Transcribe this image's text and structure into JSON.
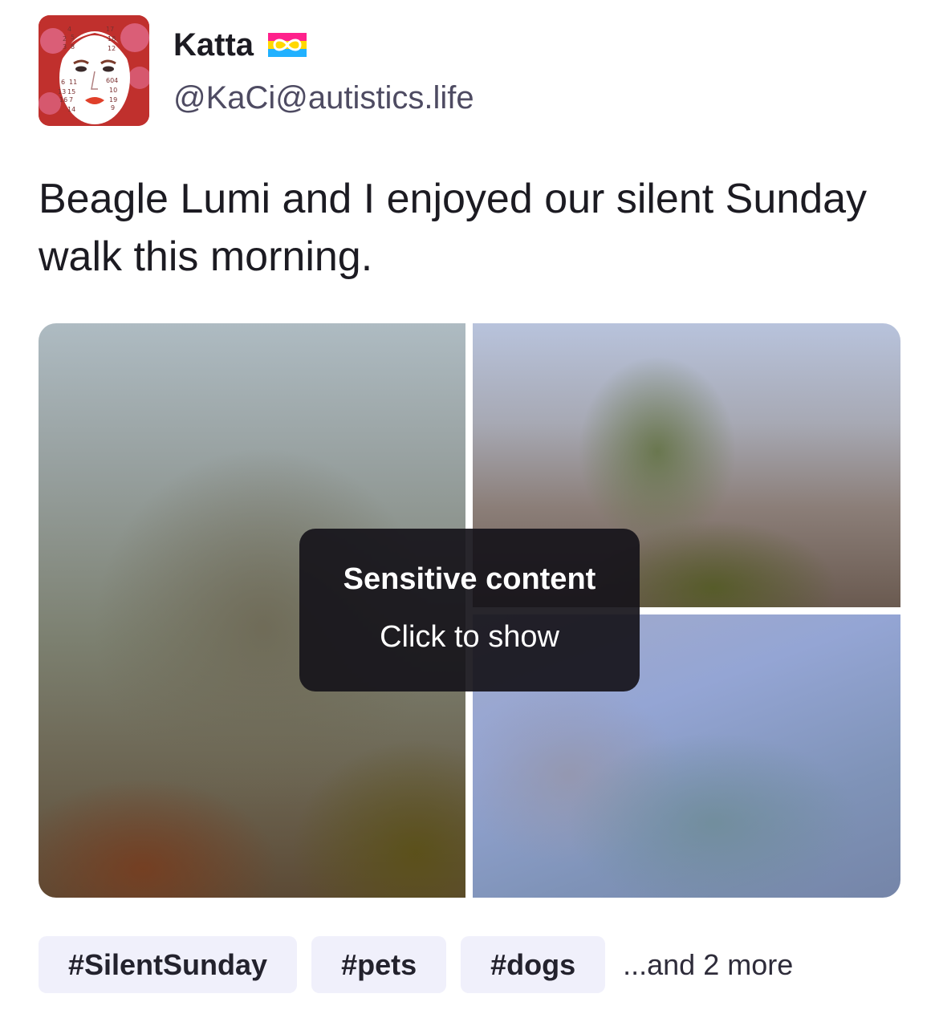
{
  "account": {
    "display_name": "Katta",
    "flag_icon": "pansexual-infinity-flag-icon",
    "handle": "@KaCi@autistics.life",
    "avatar_numbers": [
      "4",
      "17",
      "2",
      "5",
      "18",
      "3",
      "8",
      "12",
      "6",
      "11",
      "604",
      "13",
      "15",
      "10",
      "16",
      "7",
      "19",
      "14",
      "9"
    ]
  },
  "post": {
    "text": "Beagle Lumi and I enjoyed our silent Sunday walk this morning."
  },
  "media": {
    "sensitive_title": "Sensitive content",
    "sensitive_action": "Click to show",
    "image_count": 3
  },
  "tags": {
    "items": [
      "#SilentSunday",
      "#pets",
      "#dogs"
    ],
    "more_label": "...and 2 more"
  },
  "colors": {
    "avatar_background": "#c0302d",
    "tag_background": "#f0f0fb",
    "overlay_background": "#16141a",
    "handle_color": "#4e4b62"
  }
}
